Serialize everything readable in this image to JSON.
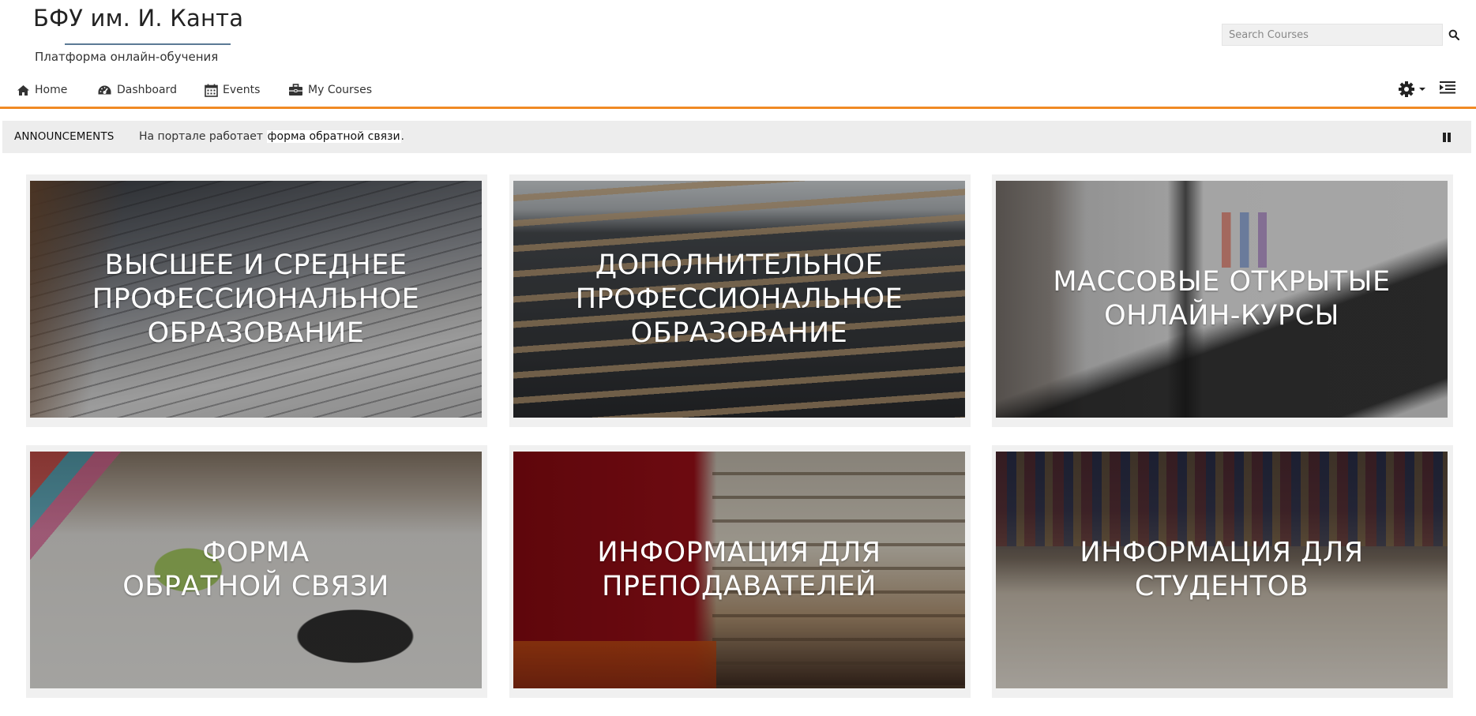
{
  "header": {
    "logo_title": "БФУ им. И. Канта",
    "logo_subtitle": "Платформа онлайн-обучения",
    "search_placeholder": "Search Courses",
    "search_icon": "search-icon"
  },
  "nav": {
    "items": [
      {
        "label": "Home",
        "icon": "home-icon"
      },
      {
        "label": "Dashboard",
        "icon": "dashboard-icon"
      },
      {
        "label": "Events",
        "icon": "calendar-icon"
      },
      {
        "label": "My Courses",
        "icon": "briefcase-icon"
      }
    ],
    "settings_icon": "gear-icon",
    "toggle_icon": "indent-icon"
  },
  "announcements": {
    "label": "ANNOUNCEMENTS",
    "text_before": "На портале работает ",
    "link_text": "форма обратной связи",
    "text_after": ".",
    "pause_icon": "pause-icon"
  },
  "tiles": [
    {
      "label": "ВЫСШЕЕ И СРЕДНЕЕ\nПРОФЕССИОНАЛЬНОЕ\nОБРАЗОВАНИЕ"
    },
    {
      "label": "ДОПОЛНИТЕЛЬНОЕ\nПРОФЕССИОНАЛЬНОЕ\nОБРАЗОВАНИЕ"
    },
    {
      "label": "МАССОВЫЕ ОТКРЫТЫЕ\nОНЛАЙН-КУРСЫ"
    },
    {
      "label": "ФОРМА\nОБРАТНОЙ СВЯЗИ"
    },
    {
      "label": "ИНФОРМАЦИЯ ДЛЯ\nПРЕПОДАВАТЕЛЕЙ"
    },
    {
      "label": "ИНФОРМАЦИЯ ДЛЯ\nСТУДЕНТОВ"
    }
  ],
  "colors": {
    "accent": "#f08a24",
    "announce_bg": "#ededed"
  }
}
